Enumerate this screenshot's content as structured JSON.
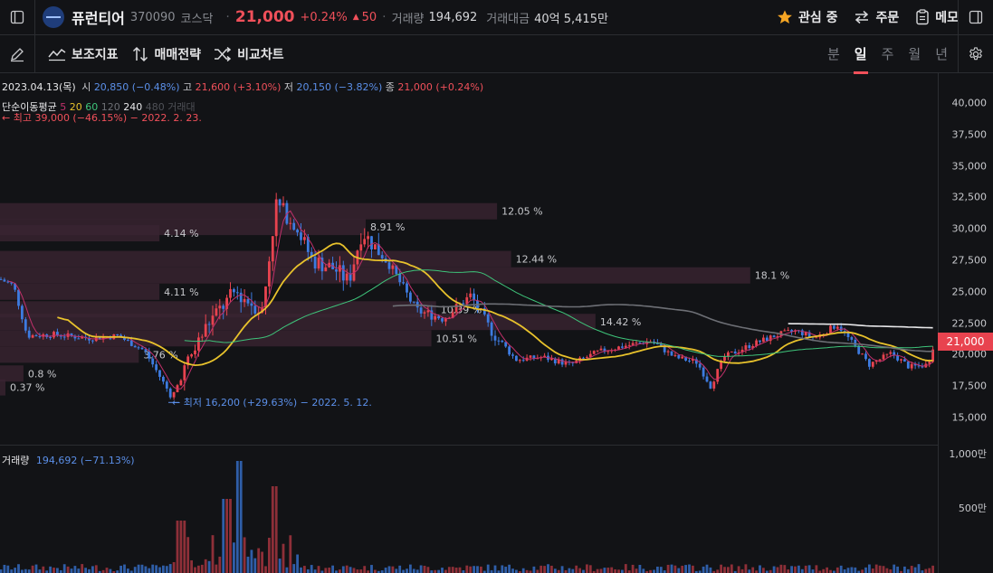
{
  "header": {
    "stock_name": "퓨런티어",
    "stock_code": "370090",
    "market": "코스닥",
    "price": "21,000",
    "change_pct": "+0.24%",
    "change_arrow": "▲",
    "change_amt": "50",
    "volume_label": "거래량",
    "volume_value": "194,692",
    "amount_label": "거래대금",
    "amount_value": "40억 5,415만",
    "watch_label": "관심 중",
    "order_label": "주문",
    "memo_label": "메모"
  },
  "toolbar": {
    "indicator_label": "보조지표",
    "strategy_label": "매매전략",
    "compare_label": "비교차트",
    "periods": [
      "분",
      "일",
      "주",
      "월",
      "년"
    ],
    "active_period": "일"
  },
  "info": {
    "date": "2023.04.13(목)",
    "open_label": "시",
    "open": "20,850 (−0.48%)",
    "high_label": "고",
    "high": "21,600 (+3.10%)",
    "low_label": "저",
    "low": "20,150 (−3.82%)",
    "close_label": "종",
    "close": "21,000 (+0.24%)",
    "ma_label": "단순이동평균",
    "ma_periods": [
      "5",
      "20",
      "60",
      "120",
      "240",
      "480"
    ],
    "ma_colors": [
      "#c2306b",
      "#e8c22c",
      "#3ec47a",
      "#7d7f85",
      "#e8e8ea",
      "#5a5c62"
    ],
    "ma_extra": "거래대",
    "max_note": "← 최고 39,000 (−46.15%) − 2022. 2. 23.",
    "min_note": "← 최저 16,200 (+29.63%) − 2022. 5. 12.",
    "volume_title": "거래량",
    "volume_note": "194,692 (−71.13%)"
  },
  "chart_data": {
    "type": "candlestick",
    "period": "daily",
    "last_date": "2023.04.13",
    "ylim": [
      13500,
      42500
    ],
    "yticks": [
      40000,
      37500,
      35000,
      32500,
      30000,
      27500,
      25000,
      22500,
      20000,
      17500,
      15000
    ],
    "ytick_labels": [
      "40,000",
      "37,500",
      "35,000",
      "32,500",
      "30,000",
      "27,500",
      "25,000",
      "22,500",
      "20,000",
      "17,500",
      "15,000"
    ],
    "current_price": 21000,
    "current_price_label": "21,000",
    "volume_ticks": [
      "1,000만",
      "500만"
    ],
    "volume_profile": [
      {
        "pct": "12.05 %",
        "price": 31400,
        "frac": 0.53
      },
      {
        "pct": "8.91 %",
        "price": 30150,
        "frac": 0.39
      },
      {
        "pct": "4.14 %",
        "price": 29650,
        "frac": 0.17
      },
      {
        "pct": "12.44 %",
        "price": 27600,
        "frac": 0.545
      },
      {
        "pct": "18.1 %",
        "price": 26300,
        "frac": 0.8
      },
      {
        "pct": "4.11 %",
        "price": 25000,
        "frac": 0.17
      },
      {
        "pct": "10.39 %",
        "price": 23600,
        "frac": 0.465
      },
      {
        "pct": "14.42 %",
        "price": 22600,
        "frac": 0.635
      },
      {
        "pct": "10.51 %",
        "price": 21300,
        "frac": 0.46
      },
      {
        "pct": "3.76 %",
        "price": 20000,
        "frac": 0.148
      },
      {
        "pct": "0.8 %",
        "price": 18500,
        "frac": 0.025
      },
      {
        "pct": "0.37 %",
        "price": 17400,
        "frac": 0.0
      }
    ],
    "max_price": 39000,
    "min_price": 16200
  }
}
